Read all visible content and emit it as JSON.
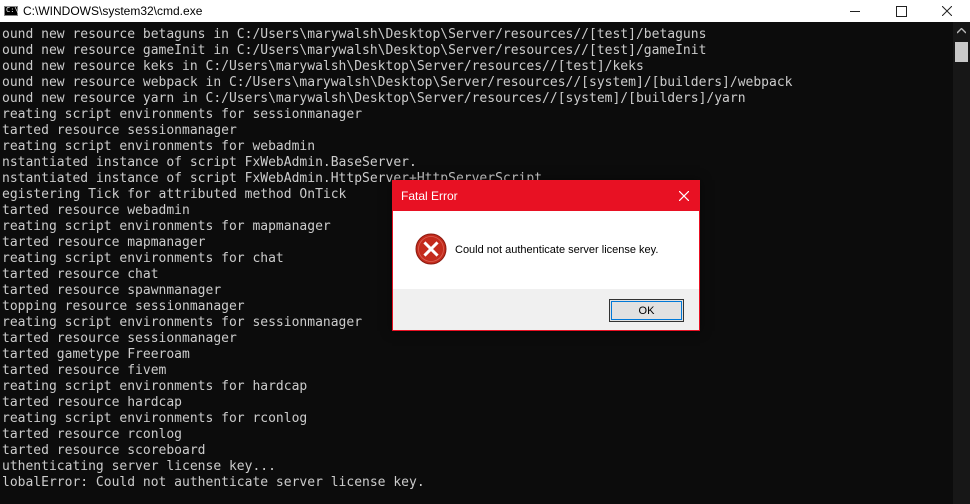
{
  "window": {
    "title": "C:\\WINDOWS\\system32\\cmd.exe",
    "icon_label": "C:\\"
  },
  "console": {
    "lines": [
      "ound new resource betaguns in C:/Users\\marywalsh\\Desktop\\Server/resources//[test]/betaguns",
      "ound new resource gameInit in C:/Users\\marywalsh\\Desktop\\Server/resources//[test]/gameInit",
      "ound new resource keks in C:/Users\\marywalsh\\Desktop\\Server/resources//[test]/keks",
      "ound new resource webpack in C:/Users\\marywalsh\\Desktop\\Server/resources//[system]/[builders]/webpack",
      "ound new resource yarn in C:/Users\\marywalsh\\Desktop\\Server/resources//[system]/[builders]/yarn",
      "reating script environments for sessionmanager",
      "tarted resource sessionmanager",
      "reating script environments for webadmin",
      "nstantiated instance of script FxWebAdmin.BaseServer.",
      "nstantiated instance of script FxWebAdmin.HttpServer+HttpServerScript.",
      "egistering Tick for attributed method OnTick",
      "tarted resource webadmin",
      "reating script environments for mapmanager",
      "tarted resource mapmanager",
      "reating script environments for chat",
      "tarted resource chat",
      "tarted resource spawnmanager",
      "topping resource sessionmanager",
      "reating script environments for sessionmanager",
      "tarted resource sessionmanager",
      "tarted gametype Freeroam",
      "tarted resource fivem",
      "reating script environments for hardcap",
      "tarted resource hardcap",
      "reating script environments for rconlog",
      "tarted resource rconlog",
      "tarted resource scoreboard",
      "uthenticating server license key...",
      "lobalError: Could not authenticate server license key."
    ]
  },
  "dialog": {
    "title": "Fatal Error",
    "message": "Could not authenticate server license key.",
    "ok_label": "OK",
    "icon": "error-icon"
  },
  "colors": {
    "console_bg": "#0c0c0c",
    "console_text": "#cccccc",
    "dialog_accent": "#e81123",
    "focus": "#0078d7"
  }
}
